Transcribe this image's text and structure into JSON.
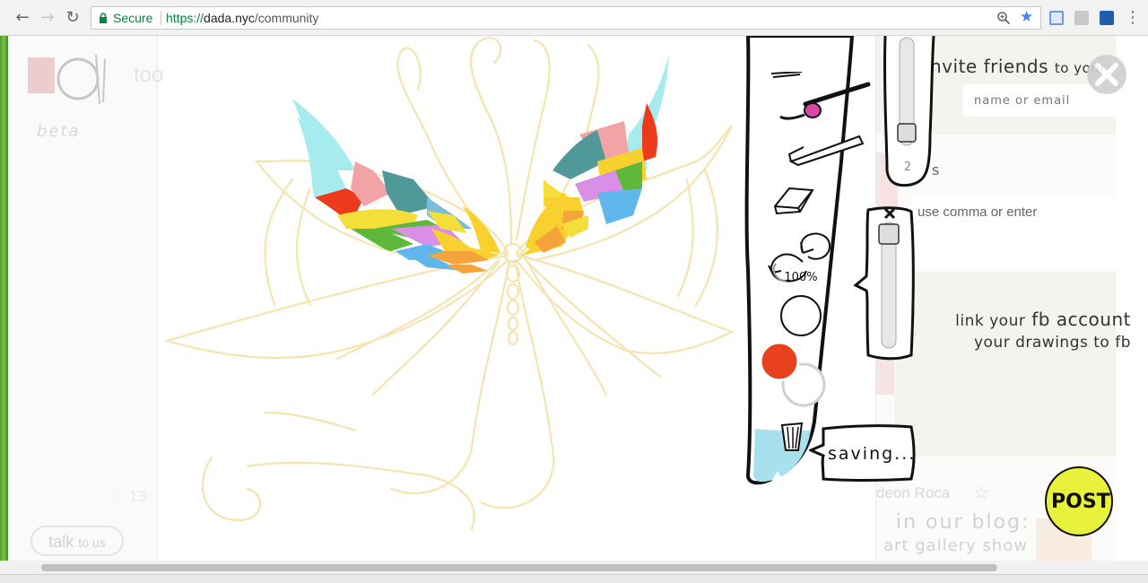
{
  "browser": {
    "secure_label": "Secure",
    "url_scheme": "https://",
    "url_host": "dada.nyc",
    "url_path": "/community",
    "accent": "#4285f4",
    "secure_color": "#0b8043"
  },
  "left": {
    "brand_partial": "too",
    "beta_label": "beta",
    "heart_count": "13",
    "talk_label": "talk",
    "talk_suffix": "to us"
  },
  "right": {
    "invite_title": "nvite friends",
    "invite_suffix": "to your",
    "invite_placeholder": "name or email",
    "s_fragment": "s",
    "comma_hint": "use comma or enter",
    "fb_line1_pre": "link your",
    "fb_line1_main": "fb account",
    "fb_line2": "your drawings to fb",
    "user_name": "deon Roca",
    "blog_line1": "in our blog:",
    "blog_line2": "art gallery show"
  },
  "tools": {
    "zoom_label": "100%",
    "brush_size": "2",
    "saving_label": "saving...",
    "current_color": "#e8401c",
    "post_label": "POST",
    "post_color": "#e9f23a"
  },
  "icons": {
    "close": "close-icon",
    "brush": "brush-icon",
    "pen": "pen-icon",
    "eraser": "eraser-icon",
    "undo": "undo-icon",
    "redo": "redo-icon",
    "trash": "trash-icon",
    "upload": "upload-arrow-icon"
  }
}
